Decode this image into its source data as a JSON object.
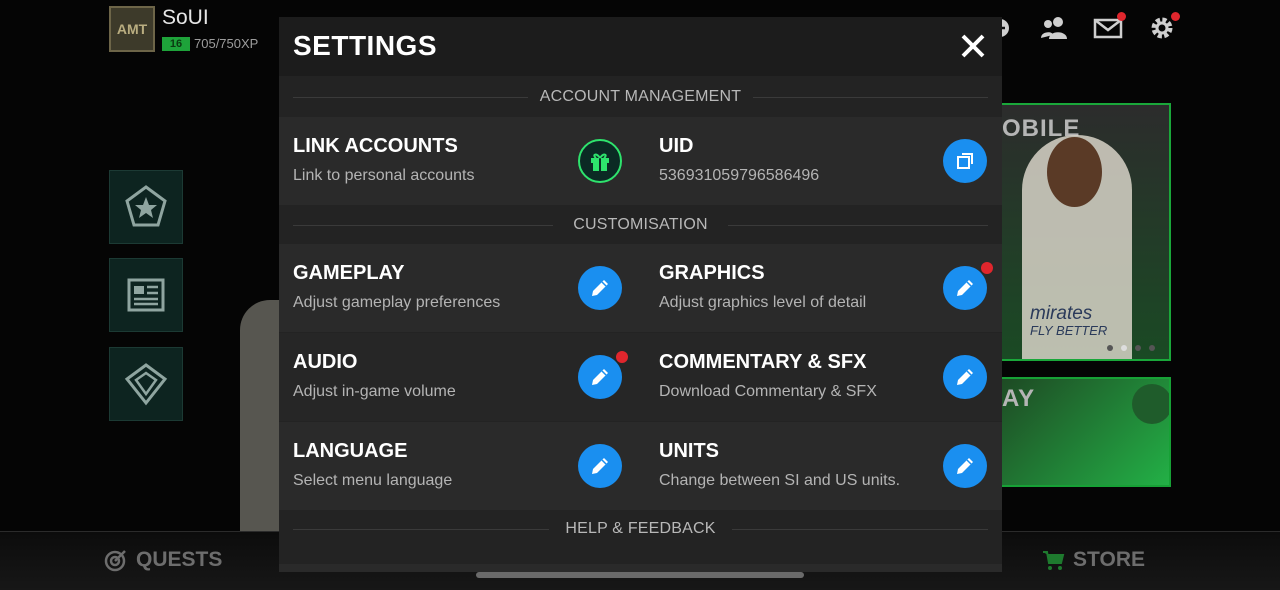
{
  "background": {
    "player": {
      "avatar_text": "AMT",
      "name": "SoUI",
      "level": "16",
      "xp": "705/750XP"
    },
    "promo1": {
      "title": "OBILE",
      "shirt_text": "mirates",
      "shirt_sub": "FLY BETTER"
    },
    "promo2": {
      "title": "AY"
    },
    "bottom": {
      "quests_label": "QUESTS",
      "store_label": "STORE"
    }
  },
  "settings": {
    "title": "SETTINGS",
    "sections": {
      "account": "ACCOUNT MANAGEMENT",
      "customisation": "CUSTOMISATION",
      "help": "HELP & FEEDBACK"
    },
    "items": {
      "link_accounts": {
        "title": "LINK ACCOUNTS",
        "subtitle": "Link to personal accounts",
        "icon": "gift-icon"
      },
      "uid": {
        "title": "UID",
        "subtitle": "536931059796586496",
        "icon": "copy-icon"
      },
      "gameplay": {
        "title": "GAMEPLAY",
        "subtitle": "Adjust gameplay preferences",
        "icon": "pencil-icon"
      },
      "graphics": {
        "title": "GRAPHICS",
        "subtitle": "Adjust graphics level of detail",
        "icon": "pencil-icon"
      },
      "audio": {
        "title": "AUDIO",
        "subtitle": "Adjust in-game volume",
        "icon": "pencil-icon"
      },
      "commentary": {
        "title": "COMMENTARY & SFX",
        "subtitle": "Download Commentary & SFX",
        "icon": "pencil-icon"
      },
      "language": {
        "title": "LANGUAGE",
        "subtitle": "Select menu language",
        "icon": "pencil-icon"
      },
      "units": {
        "title": "UNITS",
        "subtitle": "Change between SI and US units.",
        "icon": "pencil-icon"
      }
    }
  },
  "colors": {
    "accent_blue": "#1a8ff0",
    "gift_green": "#2ee36d",
    "notification_red": "#e0262d"
  }
}
